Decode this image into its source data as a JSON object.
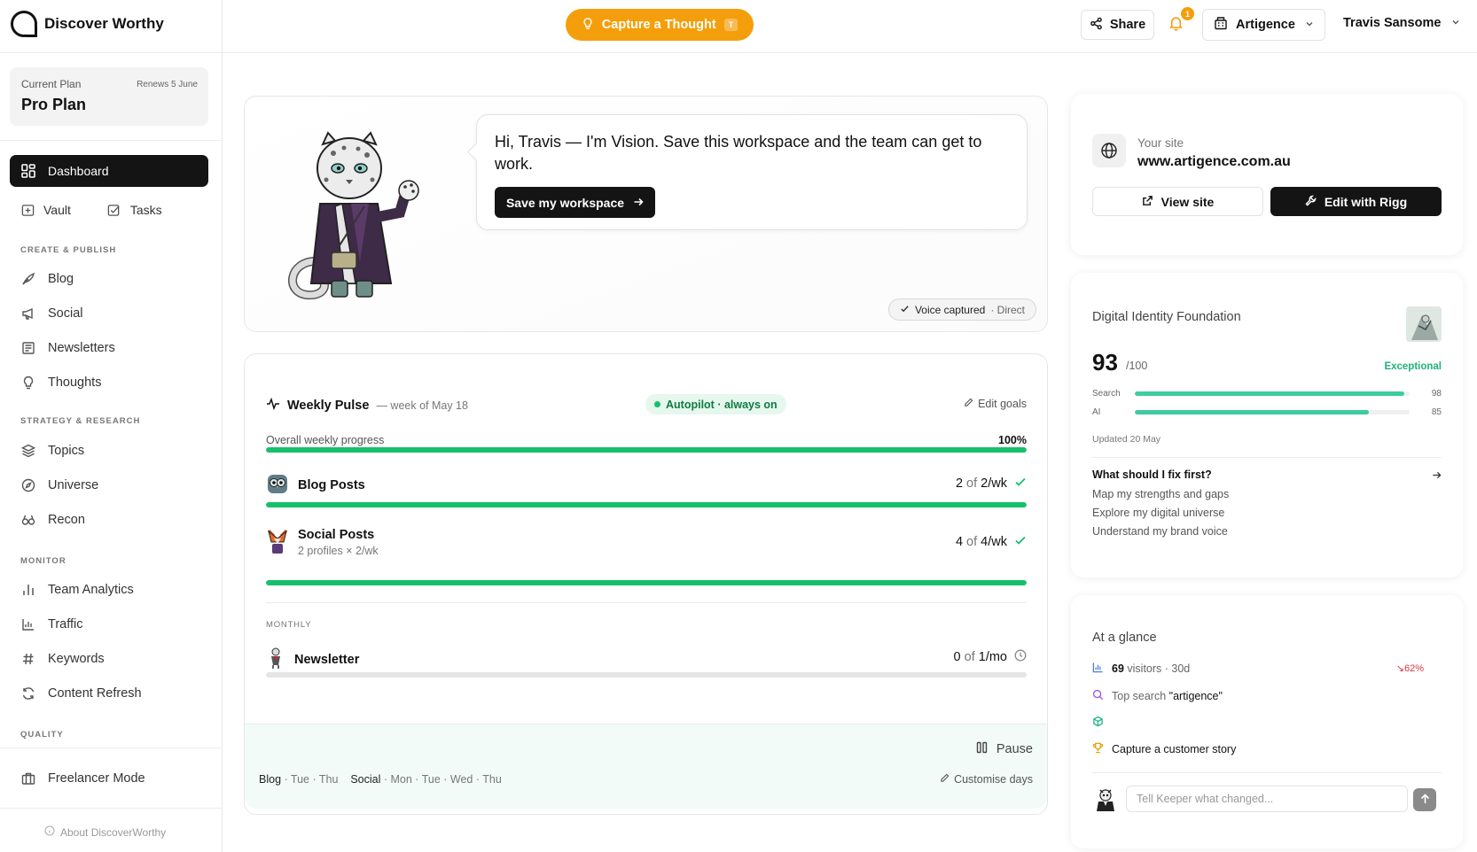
{
  "app": {
    "name": "Discover Worthy"
  },
  "plan": {
    "label": "Current Plan",
    "renews": "Renews 5 June",
    "name": "Pro Plan"
  },
  "nav": {
    "dashboard": "Dashboard",
    "vault": "Vault",
    "tasks": "Tasks",
    "sections": [
      {
        "title": "CREATE & PUBLISH",
        "items": [
          "Blog",
          "Social",
          "Newsletters",
          "Thoughts"
        ]
      },
      {
        "title": "STRATEGY & RESEARCH",
        "items": [
          "Topics",
          "Universe",
          "Recon"
        ]
      },
      {
        "title": "MONITOR",
        "items": [
          "Team Analytics",
          "Traffic",
          "Keywords",
          "Content Refresh"
        ]
      },
      {
        "title": "QUALITY",
        "items": []
      }
    ],
    "freelancer": "Freelancer Mode",
    "about": "About DiscoverWorthy"
  },
  "topbar": {
    "capture_label": "Capture a Thought",
    "capture_shortcut": "T",
    "share_label": "Share",
    "notification_count": "1",
    "org_name": "Artigence",
    "user_name": "Travis Sansome",
    "accent": "#f59e0b"
  },
  "hero": {
    "message": "Hi, Travis — I'm Vision. Save this workspace and the team can get to work.",
    "save_label": "Save my workspace",
    "voice_status": "Voice captured",
    "voice_mode": "· Direct"
  },
  "pulse": {
    "title": "Weekly Pulse",
    "week": "— week of May 18",
    "autopilot": "Autopilot · always on",
    "edit_goals": "Edit goals",
    "overall_label": "Overall weekly progress",
    "overall_value": "100%",
    "overall_progress": 1.0,
    "rows": [
      {
        "name": "Blog Posts",
        "sub": "",
        "done": "2",
        "of": "of",
        "target": "2/wk",
        "progress": 1.0
      },
      {
        "name": "Social Posts",
        "sub": "2 profiles × 2/wk",
        "done": "4",
        "of": "of",
        "target": "4/wk",
        "progress": 1.0
      }
    ],
    "monthly_label": "MONTHLY",
    "monthly": {
      "name": "Newsletter",
      "done": "0",
      "of": "of",
      "target": "1/mo",
      "progress": 0.0
    },
    "pause_label": "Pause",
    "schedule_blog_label": "Blog",
    "schedule_blog_days": "· Tue · Thu",
    "schedule_social_label": "Social",
    "schedule_social_days": "· Mon · Tue · Wed · Thu",
    "customise_label": "Customise days",
    "bar_color": "#16c06b"
  },
  "site": {
    "label": "Your site",
    "url": "www.artigence.com.au",
    "view_label": "View site",
    "edit_label": "Edit with Rigg"
  },
  "identity": {
    "title": "Digital Identity Foundation",
    "score": "93",
    "max": "/100",
    "rating": "Exceptional",
    "metrics": [
      {
        "label": "Search",
        "value": 98
      },
      {
        "label": "AI",
        "value": 85
      }
    ],
    "updated": "Updated 20 May",
    "fix_title": "What should I fix first?",
    "fix_items": [
      "Map my strengths and gaps",
      "Explore my digital universe",
      "Understand my brand voice"
    ],
    "bar_color": "#3ecca0"
  },
  "glance": {
    "title": "At a glance",
    "visitors_count": "69",
    "visitors_text": "visitors · 30d",
    "visitors_trend": "↘62%",
    "top_search_label": "Top search",
    "top_search_value": "\"artigence\"",
    "story": "Capture a customer story",
    "input_placeholder": "Tell Keeper what changed..."
  }
}
